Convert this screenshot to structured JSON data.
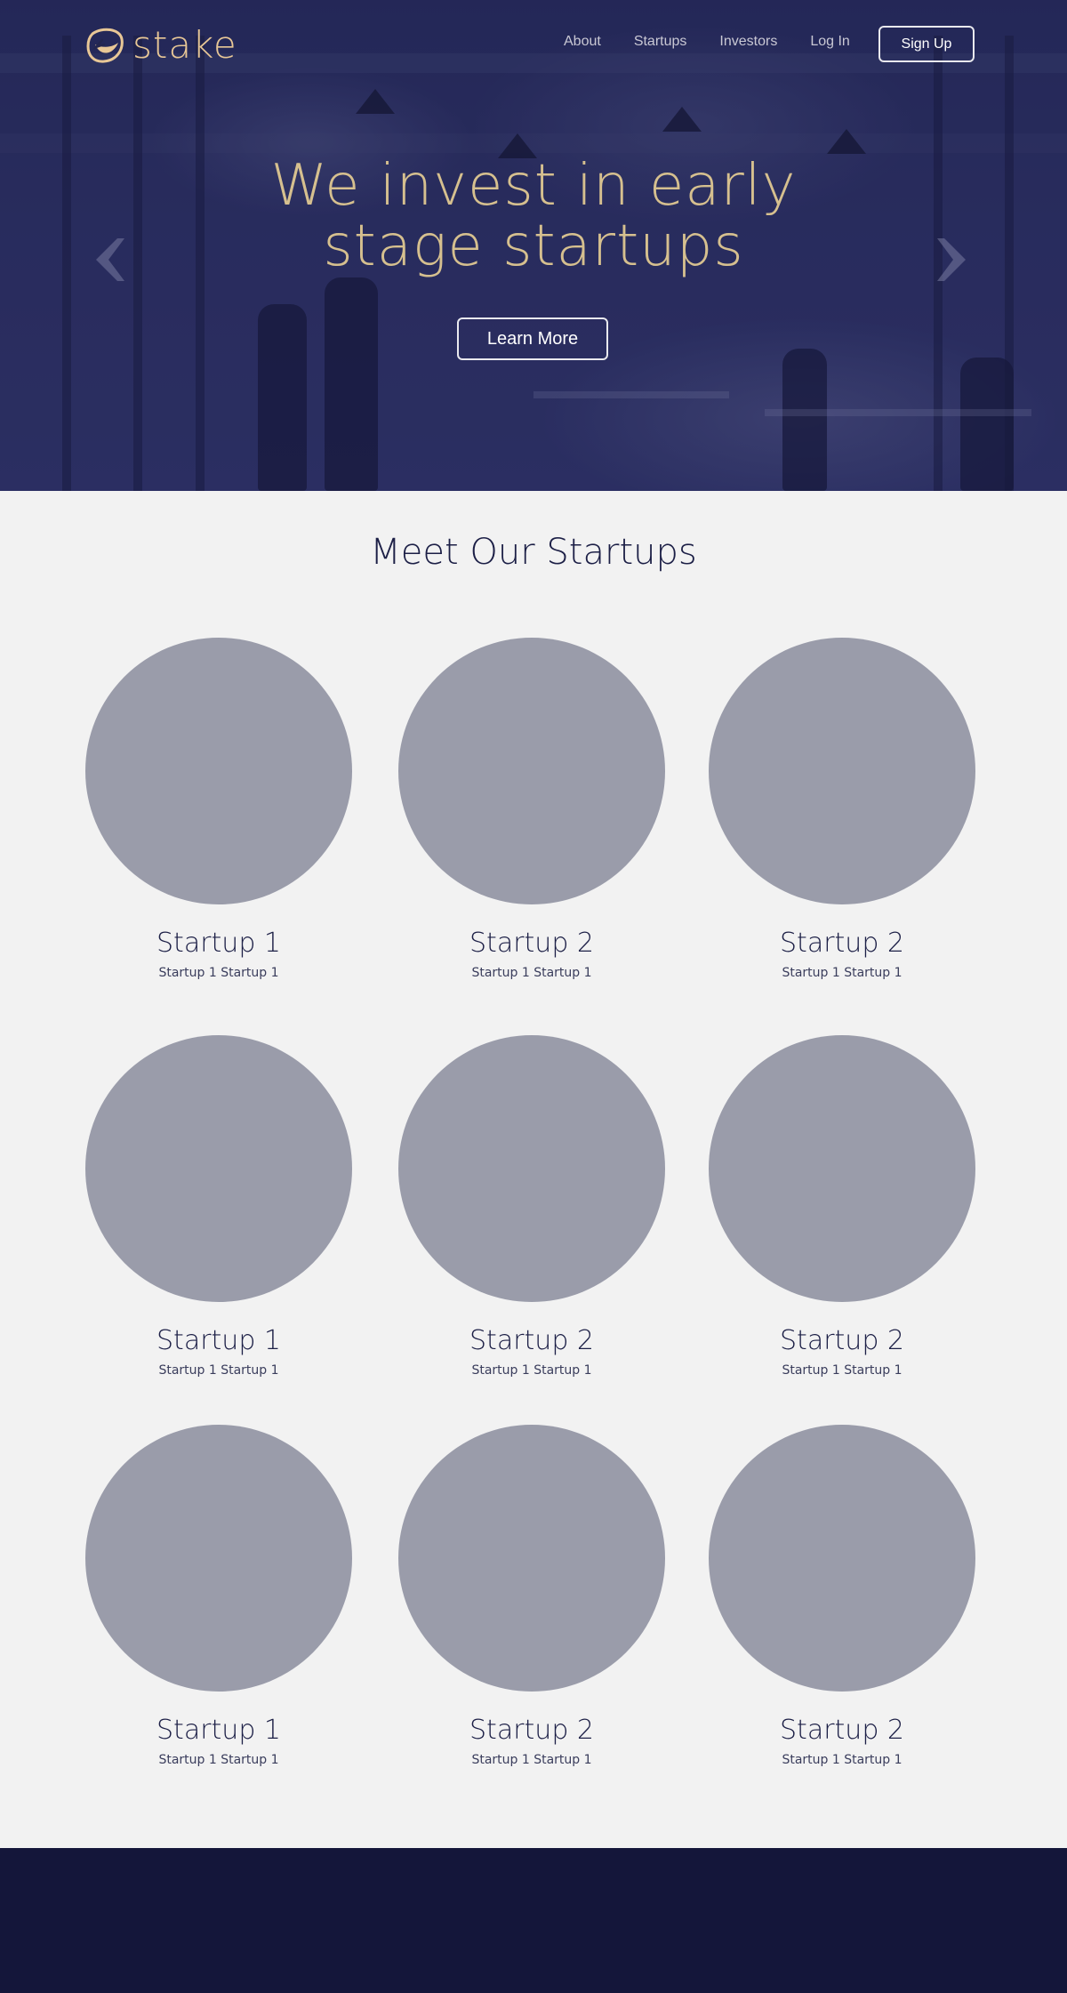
{
  "brand": {
    "name": "stake",
    "logo_icon": "stake-logo-icon",
    "color": "#e8c796"
  },
  "nav": {
    "links": [
      "About",
      "Startups",
      "Investors",
      "Log In"
    ],
    "signup_label": "Sign Up"
  },
  "hero": {
    "title_line1": "We invest in early",
    "title_line2": "stage startups",
    "cta_label": "Learn More",
    "prev_icon": "chevron-left-icon",
    "next_icon": "chevron-right-icon",
    "title_color": "#d6c08f"
  },
  "startups": {
    "title": "Meet Our Startups",
    "items": [
      {
        "name": "Startup 1",
        "desc": "Startup 1 Startup 1"
      },
      {
        "name": "Startup 2",
        "desc": "Startup 1 Startup 1"
      },
      {
        "name": "Startup 2",
        "desc": "Startup 1 Startup 1"
      },
      {
        "name": "Startup 1",
        "desc": "Startup 1 Startup 1"
      },
      {
        "name": "Startup 2",
        "desc": "Startup 1 Startup 1"
      },
      {
        "name": "Startup 2",
        "desc": "Startup 1 Startup 1"
      },
      {
        "name": "Startup 1",
        "desc": "Startup 1 Startup 1"
      },
      {
        "name": "Startup 2",
        "desc": "Startup 1 Startup 1"
      },
      {
        "name": "Startup 2",
        "desc": "Startup 1 Startup 1"
      }
    ]
  },
  "colors": {
    "navy": "#14163a",
    "placeholder": "#9a9caa",
    "background": "#f2f2f2"
  }
}
